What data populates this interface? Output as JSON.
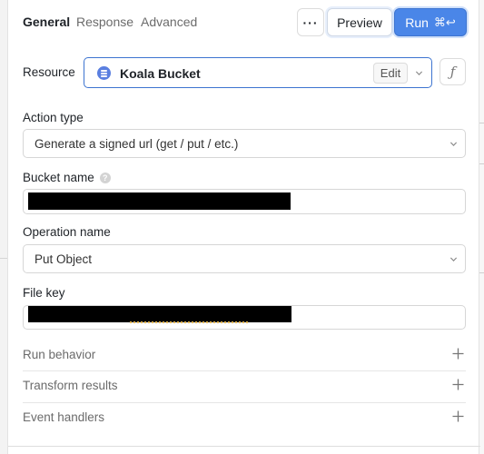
{
  "header": {
    "tabs": [
      {
        "label": "General",
        "active": true
      },
      {
        "label": "Response",
        "active": false
      },
      {
        "label": "Advanced",
        "active": false
      }
    ],
    "more_label": "···",
    "preview_label": "Preview",
    "run_label": "Run",
    "run_shortcut": "⌘↩"
  },
  "resource": {
    "label": "Resource",
    "name": "Koala Bucket",
    "edit_label": "Edit",
    "fx_label": "ƒ"
  },
  "action_type": {
    "label": "Action type",
    "value": "Generate a signed url (get / put / etc.)"
  },
  "bucket_name": {
    "label": "Bucket name",
    "help": "?",
    "value_redacted": true
  },
  "operation_name": {
    "label": "Operation name",
    "value": "Put Object"
  },
  "file_key": {
    "label": "File key",
    "value_redacted": true
  },
  "sections": [
    {
      "label": "Run behavior"
    },
    {
      "label": "Transform results"
    },
    {
      "label": "Event handlers"
    }
  ],
  "colors": {
    "accent": "#4a86e8",
    "resource_icon": "#5a7fe0",
    "border": "#d6d6d6"
  }
}
